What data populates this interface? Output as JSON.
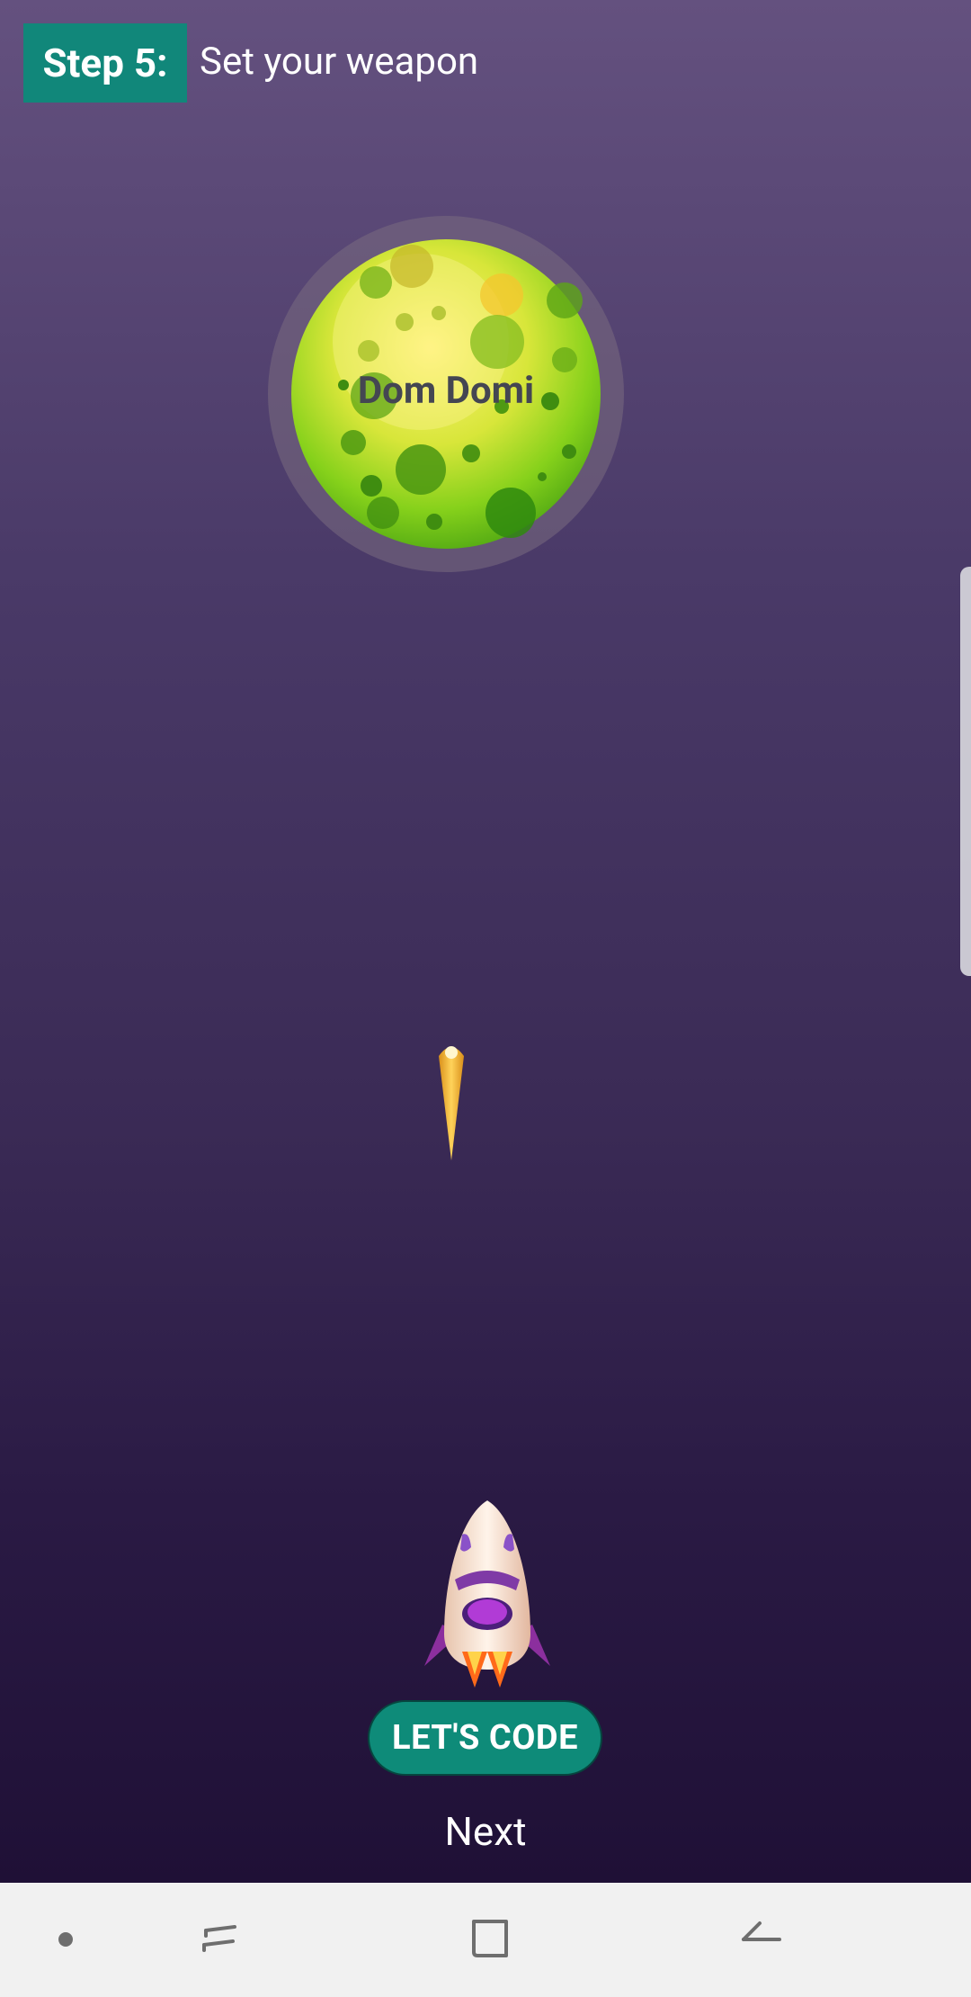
{
  "step": {
    "badge": "Step 5:",
    "title": "Set your weapon"
  },
  "planet": {
    "label": "Dom Domi"
  },
  "buttons": {
    "lets_code": "LET'S CODE",
    "next": "Next"
  },
  "nav": {
    "icons": [
      "dot-icon",
      "recents-icon",
      "home-icon",
      "back-icon"
    ]
  },
  "colors": {
    "accent": "#11877a",
    "button": "#0e8b79",
    "navbar": "#f1f1f1"
  }
}
